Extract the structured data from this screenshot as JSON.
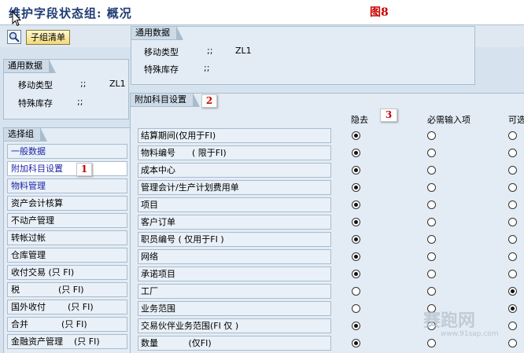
{
  "title": "维护字段状态组: 概况",
  "figure_label": "图8",
  "toolbar": {
    "sublist_button": "子组清单"
  },
  "general_top": {
    "tab": "通用数据",
    "fields": [
      {
        "label": "移动类型",
        "sep": ";;",
        "value": "ZL1"
      },
      {
        "label": "特殊库存",
        "sep": ";;",
        "value": ""
      }
    ]
  },
  "general_left": {
    "tab": "通用数据",
    "fields": [
      {
        "label": "移动类型",
        "sep": ";;",
        "value": "ZL1"
      },
      {
        "label": "特殊库存",
        "sep": ";;",
        "value": ""
      }
    ]
  },
  "select_group": {
    "tab": "选择组",
    "items": [
      {
        "label": "一般数据",
        "link": true
      },
      {
        "label": "附加科目设置",
        "link": true,
        "active": true
      },
      {
        "label": "物料管理",
        "link": true
      },
      {
        "label": "资产会计核算",
        "link": false
      },
      {
        "label": "不动产管理",
        "link": false
      },
      {
        "label": "转帐过帐",
        "link": false
      },
      {
        "label": "仓库管理",
        "link": false
      },
      {
        "label": "收付交易 (只 FI)",
        "link": false
      },
      {
        "label": "税              (只 FI)",
        "link": false
      },
      {
        "label": "国外收付        (只 FI)",
        "link": false
      },
      {
        "label": "合并            (只 FI)",
        "link": false
      },
      {
        "label": "金融资产管理    (只 FI)",
        "link": false
      }
    ]
  },
  "field_settings": {
    "tab": "附加科目设置",
    "columns": {
      "hide": "隐去",
      "required": "必需输入项",
      "optional": "可选"
    },
    "rows": [
      {
        "label": "结算期间(仅用于FI)",
        "state": "hide"
      },
      {
        "label": "物料编号      ( 限于FI)",
        "state": "hide"
      },
      {
        "label": "成本中心",
        "state": "hide"
      },
      {
        "label": "管理会计/生产计划费用单",
        "state": "hide"
      },
      {
        "label": "项目",
        "state": "hide"
      },
      {
        "label": "客户订单",
        "state": "hide"
      },
      {
        "label": "职员编号 ( 仅用于FI )",
        "state": "hide"
      },
      {
        "label": "网络",
        "state": "hide"
      },
      {
        "label": "承诺项目",
        "state": "hide"
      },
      {
        "label": "工厂",
        "state": "optional"
      },
      {
        "label": "业务范围",
        "state": "optional"
      },
      {
        "label": "交易伙伴业务范围(FI 仅 )",
        "state": "hide"
      },
      {
        "label": "数量           (仅FI)",
        "state": "hide"
      }
    ]
  },
  "badges": [
    "1",
    "2",
    "3"
  ],
  "watermark": {
    "text": "赛跑网",
    "url": "www.91sap.com"
  },
  "colors": {
    "link": "#1d26a8",
    "badge": "#cc0000",
    "panel": "#e3ecf5"
  }
}
